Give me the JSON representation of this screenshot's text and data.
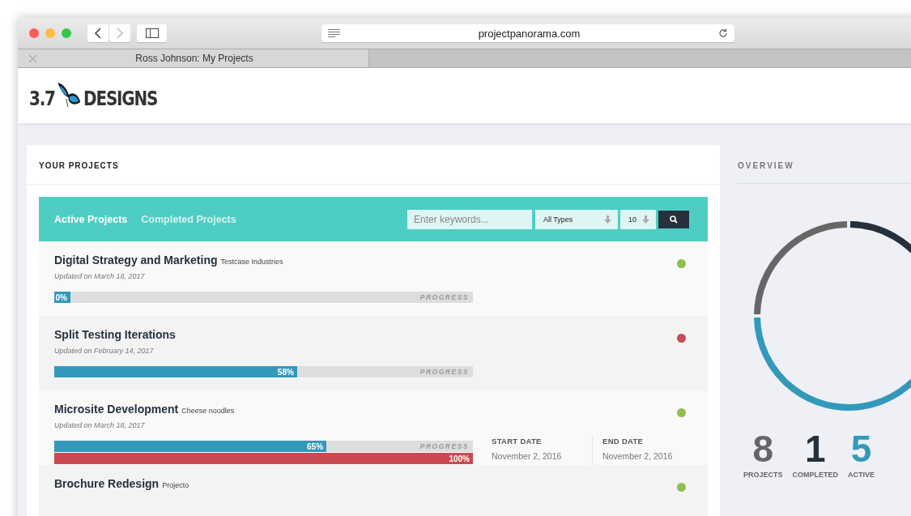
{
  "browser": {
    "address": "projectpanorama.com",
    "tab_title": "Ross Johnson: My Projects"
  },
  "logo": {
    "number": "3.7",
    "word": "DESIGNS"
  },
  "projects_panel": {
    "title": "YOUR PROJECTS",
    "tabs": [
      {
        "label": "Active Projects",
        "selected": true
      },
      {
        "label": "Completed Projects",
        "selected": false
      }
    ],
    "search": {
      "placeholder": "Enter keywords..."
    },
    "type_filter": "All Types",
    "page_size": "10",
    "projects": [
      {
        "name": "Digital Strategy and Marketing",
        "client": "Testcase Industries",
        "updated": "Updated on March 18, 2017",
        "color": "#8fbf4f",
        "bars": [
          {
            "level": 0,
            "label": "0%",
            "caption": "PROGRESS",
            "color": "#3399bb"
          }
        ]
      },
      {
        "name": "Split Testing Iterations",
        "updated": "Updated on February 14, 2017",
        "color": "#c94a53",
        "bars": [
          {
            "level": 0.58,
            "label": "58%",
            "caption": "PROGRESS",
            "color": "#3399bb"
          }
        ]
      },
      {
        "name": "Microsite Development",
        "client": "Cheese noodles",
        "updated": "Updated on March 18, 2017",
        "color": "#8fbf4f",
        "bars": [
          {
            "level": 0.65,
            "label": "65%",
            "caption": "PROGRESS",
            "color": "#3399bb"
          },
          {
            "level": 1,
            "label": "100%",
            "color": "#c94a53"
          }
        ],
        "dates": [
          {
            "label": "START DATE",
            "value": "November 2, 2016"
          },
          {
            "label": "END DATE",
            "value": "November 2, 2016"
          }
        ]
      },
      {
        "name": "Brochure Redesign",
        "client": "Projecto",
        "color": "#8fbf4f"
      }
    ]
  },
  "overview": {
    "title": "OVERVIEW",
    "stats": [
      {
        "value": "8",
        "label": "PROJECTS",
        "color": "#666666"
      },
      {
        "value": "1",
        "label": "COMPLETED",
        "color": "#26303d"
      },
      {
        "value": "5",
        "label": "ACTIVE",
        "color": "#3399bb"
      }
    ]
  }
}
